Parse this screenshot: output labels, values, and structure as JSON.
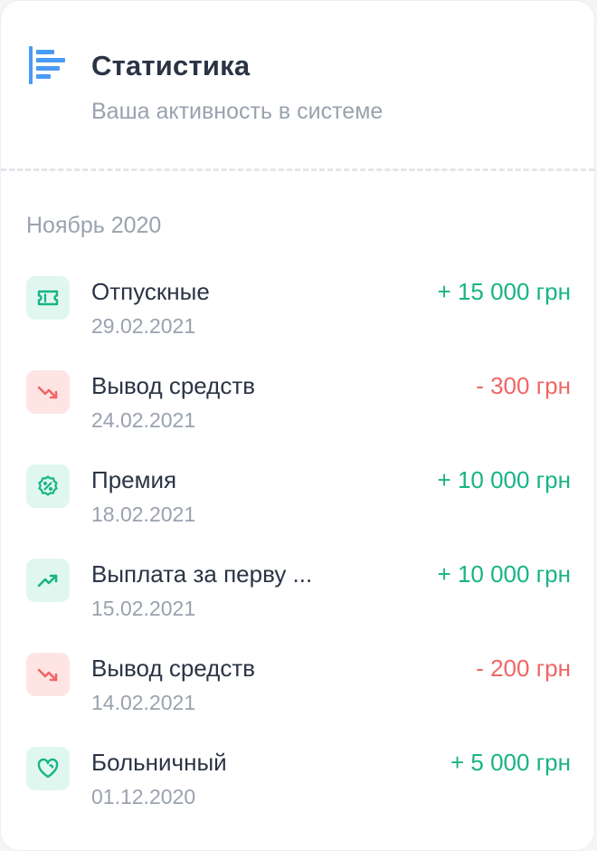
{
  "header": {
    "icon": "bar-chart-icon",
    "title": "Статистика",
    "subtitle": "Ваша активность в системе"
  },
  "month_label": "Ноябрь 2020",
  "colors": {
    "positive": "#17b484",
    "negative": "#f06565",
    "icon_accent": "#4a9bf5"
  },
  "transactions": [
    {
      "icon": "ticket-icon",
      "title": "Отпускные",
      "date": "29.02.2021",
      "amount": "+ 15 000 грн",
      "type": "positive"
    },
    {
      "icon": "trend-down-icon",
      "title": "Вывод средств",
      "date": "24.02.2021",
      "amount": "- 300 грн",
      "type": "negative"
    },
    {
      "icon": "discount-badge-icon",
      "title": "Премия",
      "date": "18.02.2021",
      "amount": "+ 10 000 грн",
      "type": "positive"
    },
    {
      "icon": "trend-up-icon",
      "title": "Выплата за перву ...",
      "date": "15.02.2021",
      "amount": "+ 10 000 грн",
      "type": "positive"
    },
    {
      "icon": "trend-down-icon",
      "title": "Вывод средств",
      "date": "14.02.2021",
      "amount": "- 200 грн",
      "type": "negative"
    },
    {
      "icon": "heart-icon",
      "title": "Больничный",
      "date": "01.12.2020",
      "amount": "+ 5 000 грн",
      "type": "positive"
    }
  ]
}
